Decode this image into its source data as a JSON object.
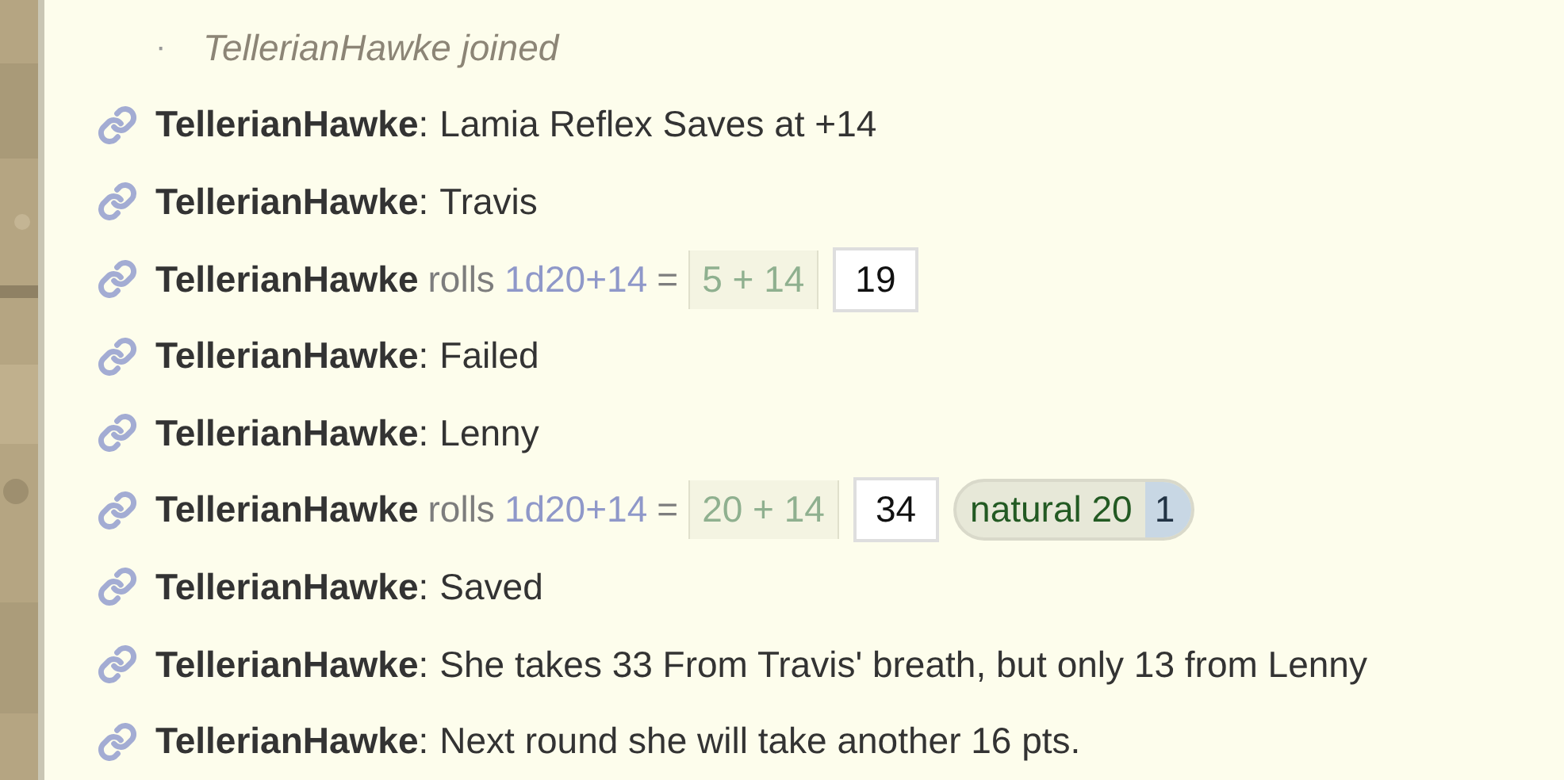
{
  "messages": [
    {
      "kind": "system",
      "bullet": "·",
      "text": "TellerianHawke joined"
    },
    {
      "kind": "chat",
      "author": "TellerianHawke",
      "separator": ":",
      "text": "Lamia Reflex Saves at +14"
    },
    {
      "kind": "chat",
      "author": "TellerianHawke",
      "separator": ":",
      "text": "Travis"
    },
    {
      "kind": "roll",
      "author": "TellerianHawke",
      "verb": "rolls",
      "formula": "1d20+14",
      "equals": "=",
      "breakdown": "5 + 14",
      "total": "19"
    },
    {
      "kind": "chat",
      "author": "TellerianHawke",
      "separator": ":",
      "text": "Failed"
    },
    {
      "kind": "chat",
      "author": "TellerianHawke",
      "separator": ":",
      "text": "Lenny"
    },
    {
      "kind": "roll",
      "author": "TellerianHawke",
      "verb": "rolls",
      "formula": "1d20+14",
      "equals": "=",
      "breakdown": "20 + 14",
      "total": "34",
      "tags": [
        {
          "label": "natural 20",
          "count": "1"
        }
      ]
    },
    {
      "kind": "chat",
      "author": "TellerianHawke",
      "separator": ":",
      "text": "Saved"
    },
    {
      "kind": "chat",
      "author": "TellerianHawke",
      "separator": ":",
      "text": "She takes 33 From Travis' breath, but only 13 from Lenny"
    },
    {
      "kind": "chat",
      "author": "TellerianHawke",
      "separator": ":",
      "text": "Next round she will take another 16 pts."
    }
  ]
}
